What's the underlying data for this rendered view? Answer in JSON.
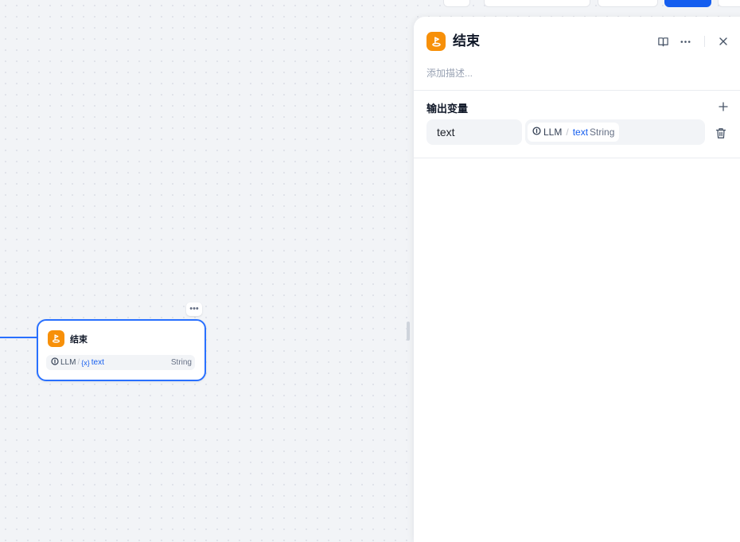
{
  "canvas": {
    "node": {
      "title": "结束",
      "icon": "end-flag-icon",
      "more_label": "•••",
      "variable": {
        "source": "LLM",
        "separator": "/",
        "var_icon": "{x}",
        "name": "text",
        "type": "String"
      }
    }
  },
  "panel": {
    "title": "结束",
    "icon": "end-flag-icon",
    "description_placeholder": "添加描述...",
    "section_title": "输出变量",
    "output": {
      "name": "text",
      "ref_source": "LLM",
      "ref_separator": "/",
      "ref_var": "text",
      "ref_type": "String"
    }
  },
  "colors": {
    "accent": "#155eef",
    "node_border": "#2970ff",
    "end_icon_bg": "#f79009"
  }
}
